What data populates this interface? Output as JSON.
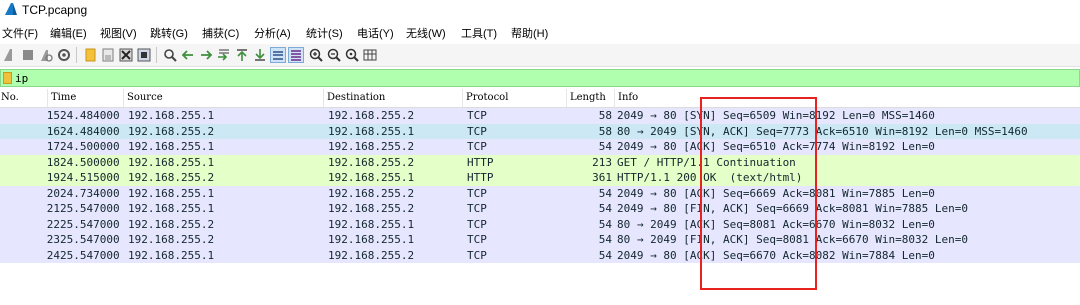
{
  "window": {
    "title": "TCP.pcapng"
  },
  "menu": [
    "文件(F)",
    "编辑(E)",
    "视图(V)",
    "跳转(G)",
    "捕获(C)",
    "分析(A)",
    "统计(S)",
    "电话(Y)",
    "无线(W)",
    "工具(T)",
    "帮助(H)"
  ],
  "toolbar_icons": [
    "start-capture-icon",
    "stop-capture-icon",
    "restart-capture-icon",
    "capture-options-icon",
    "open-file-icon",
    "save-file-icon",
    "close-file-icon",
    "reload-file-icon",
    "find-packet-icon",
    "go-back-icon",
    "go-forward-icon",
    "go-to-packet-icon",
    "go-first-icon",
    "go-last-icon",
    "autoscroll-icon",
    "colorize-icon",
    "zoom-in-icon",
    "zoom-out-icon",
    "zoom-reset-icon",
    "resize-columns-icon"
  ],
  "filter": {
    "value": "ip"
  },
  "columns": [
    "No.",
    "Time",
    "Source",
    "Destination",
    "Protocol",
    "Length",
    "Info"
  ],
  "colors": {
    "tcp_row": "#e7e6ff",
    "http_row": "#e4ffc7",
    "selected_row": "#cce8f4",
    "filter_bg": "#afffaf",
    "highlight_box": "#e8221f"
  },
  "packets": [
    {
      "no": "15",
      "time": "24.484000",
      "source": "192.168.255.1",
      "destination": "192.168.255.2",
      "protocol": "TCP",
      "length": "58",
      "info": "2049 → 80 [SYN] Seq=6509 Win=8192 Len=0 MSS=1460"
    },
    {
      "no": "16",
      "time": "24.484000",
      "source": "192.168.255.2",
      "destination": "192.168.255.1",
      "protocol": "TCP",
      "length": "58",
      "info": "80 → 2049 [SYN, ACK] Seq=7773 Ack=6510 Win=8192 Len=0 MSS=1460"
    },
    {
      "no": "17",
      "time": "24.500000",
      "source": "192.168.255.1",
      "destination": "192.168.255.2",
      "protocol": "TCP",
      "length": "54",
      "info": "2049 → 80 [ACK] Seq=6510 Ack=7774 Win=8192 Len=0"
    },
    {
      "no": "18",
      "time": "24.500000",
      "source": "192.168.255.1",
      "destination": "192.168.255.2",
      "protocol": "HTTP",
      "length": "213",
      "info": "GET / HTTP/1.1 Continuation"
    },
    {
      "no": "19",
      "time": "24.515000",
      "source": "192.168.255.2",
      "destination": "192.168.255.1",
      "protocol": "HTTP",
      "length": "361",
      "info": "HTTP/1.1 200 OK  (text/html)"
    },
    {
      "no": "20",
      "time": "24.734000",
      "source": "192.168.255.1",
      "destination": "192.168.255.2",
      "protocol": "TCP",
      "length": "54",
      "info": "2049 → 80 [ACK] Seq=6669 Ack=8081 Win=7885 Len=0"
    },
    {
      "no": "21",
      "time": "25.547000",
      "source": "192.168.255.1",
      "destination": "192.168.255.2",
      "protocol": "TCP",
      "length": "54",
      "info": "2049 → 80 [FIN, ACK] Seq=6669 Ack=8081 Win=7885 Len=0"
    },
    {
      "no": "22",
      "time": "25.547000",
      "source": "192.168.255.2",
      "destination": "192.168.255.1",
      "protocol": "TCP",
      "length": "54",
      "info": "80 → 2049 [ACK] Seq=8081 Ack=6670 Win=8032 Len=0"
    },
    {
      "no": "23",
      "time": "25.547000",
      "source": "192.168.255.2",
      "destination": "192.168.255.1",
      "protocol": "TCP",
      "length": "54",
      "info": "80 → 2049 [FIN, ACK] Seq=8081 Ack=6670 Win=8032 Len=0"
    },
    {
      "no": "24",
      "time": "25.547000",
      "source": "192.168.255.1",
      "destination": "192.168.255.2",
      "protocol": "TCP",
      "length": "54",
      "info": "2049 → 80 [ACK] Seq=6670 Ack=8082 Win=7884 Len=0"
    }
  ],
  "selected_packet": "16"
}
